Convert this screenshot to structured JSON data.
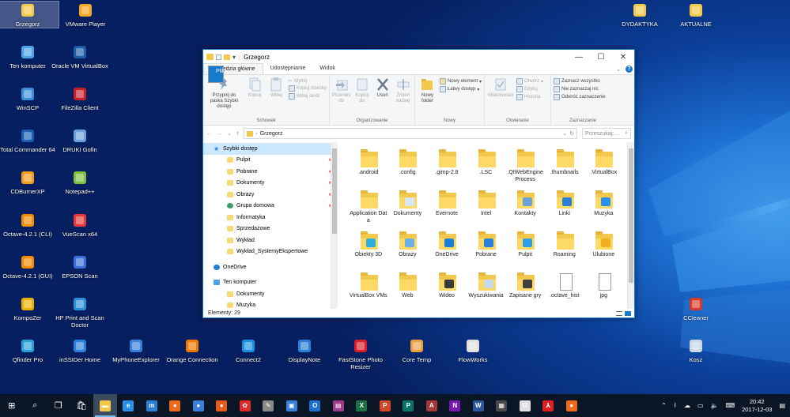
{
  "desktop_icons": [
    {
      "label": "Grzegorz",
      "icon": "user-folder-icon",
      "color": "#f2c94c"
    },
    {
      "label": "VMware Player",
      "icon": "vmware-icon",
      "color": "#f5a623"
    },
    {
      "label": "Ten komputer",
      "icon": "computer-icon",
      "color": "#4ea3e8"
    },
    {
      "label": "Oracle VM VirtualBox",
      "icon": "virtualbox-icon",
      "color": "#1d5ca8"
    },
    {
      "label": "WinSCP",
      "icon": "winscp-icon",
      "color": "#3a8fd8"
    },
    {
      "label": "FileZilla Client",
      "icon": "filezilla-icon",
      "color": "#c8202a"
    },
    {
      "label": "Total Commander 64",
      "icon": "total-commander-icon",
      "color": "#1b5fb0"
    },
    {
      "label": "DRUKI Gofin",
      "icon": "druki-gofin-icon",
      "color": "#6aa0d8"
    },
    {
      "label": "CDBurnerXP",
      "icon": "cdburnerxp-icon",
      "color": "#f29b1d"
    },
    {
      "label": "Notepad++",
      "icon": "notepad-plus-plus-icon",
      "color": "#7fbf3f"
    },
    {
      "label": "Octave-4.2.1 (CLI)",
      "icon": "octave-icon",
      "color": "#f08c00"
    },
    {
      "label": "VueScan x64",
      "icon": "vuescan-icon",
      "color": "#e83a3a"
    },
    {
      "label": "Octave-4.2.1 (GUI)",
      "icon": "octave-icon",
      "color": "#f08c00"
    },
    {
      "label": "EPSON Scan",
      "icon": "epson-scan-icon",
      "color": "#3a6fd8"
    },
    {
      "label": "KompoZer",
      "icon": "kompozer-icon",
      "color": "#e8b100"
    },
    {
      "label": "HP Print and Scan Doctor",
      "icon": "hp-doctor-icon",
      "color": "#2a8fd8"
    },
    {
      "label": "Qfinder Pro",
      "icon": "qfinder-icon",
      "color": "#2aa0d8"
    },
    {
      "label": "inSSIDer Home",
      "icon": "inssider-icon",
      "color": "#2a7fd8"
    },
    {
      "label": "MyPhoneExplorer",
      "icon": "myphoneexplorer-icon",
      "color": "#3a7fd8"
    },
    {
      "label": "Orange Connection",
      "icon": "orange-connection-icon",
      "color": "#f07800"
    },
    {
      "label": "Connect2",
      "icon": "connect2-icon",
      "color": "#1a8fe0"
    },
    {
      "label": "DisplayNote",
      "icon": "displaynote-icon",
      "color": "#2a7fd8"
    },
    {
      "label": "FastStone Photo Resizer",
      "icon": "faststone-icon",
      "color": "#d8202a"
    },
    {
      "label": "Core Temp",
      "icon": "core-temp-icon",
      "color": "#e8a040"
    },
    {
      "label": "FlowWorks",
      "icon": "flowworks-icon",
      "color": "#e0e0e0"
    },
    {
      "label": "DYDAKTYKA",
      "icon": "folder-icon",
      "color": "#f2c94c"
    },
    {
      "label": "AKTUALNE",
      "icon": "document-icon",
      "color": "#f2c94c"
    },
    {
      "label": "CCleaner",
      "icon": "ccleaner-icon",
      "color": "#d83a2a"
    },
    {
      "label": "Kosz",
      "icon": "recycle-bin-icon",
      "color": "#c8d8e8"
    }
  ],
  "window": {
    "title": "Grzegorz",
    "tabs": [
      "Plik",
      "Narzędzia główne",
      "Udostępnianie",
      "Widok"
    ],
    "active_tab": "Narzędzia główne",
    "ribbon": {
      "schowek": {
        "label": "Schowek",
        "pin": "Przypnij do paska Szybki dostęp",
        "copy": "Kopiuj",
        "paste": "Wklej",
        "cut": "Wytnij",
        "copy_path": "Kopiuj ścieżkę",
        "paste_shortcut": "Wklej skrót"
      },
      "organizowanie": {
        "label": "Organizowanie",
        "move_to": "Przenieś do",
        "copy_to": "Kopiuj do",
        "delete": "Usuń",
        "rename": "Zmień nazwę"
      },
      "nowy": {
        "label": "Nowy",
        "new_folder": "Nowy folder",
        "new_item": "Nowy element",
        "easy_access": "Łatwy dostęp"
      },
      "otwieranie": {
        "label": "Otwieranie",
        "properties": "Właściwości",
        "open": "Otwórz",
        "edit": "Edytuj",
        "history": "Historia"
      },
      "zaznaczanie": {
        "label": "Zaznaczanie",
        "select_all": "Zaznacz wszystko",
        "select_none": "Nie zaznaczaj nic",
        "invert": "Odwróć zaznaczenie"
      }
    },
    "address": {
      "path": "Grzegorz",
      "search_placeholder": "Przeszukaj:..."
    },
    "nav": [
      {
        "label": "Szybki dostęp",
        "top": true,
        "sel": true,
        "icon": "star-icon"
      },
      {
        "label": "Pulpit",
        "pin": true,
        "icon": "desktop-folder-icon"
      },
      {
        "label": "Pobrane",
        "pin": true,
        "icon": "downloads-folder-icon"
      },
      {
        "label": "Dokumenty",
        "pin": true,
        "icon": "documents-folder-icon"
      },
      {
        "label": "Obrazy",
        "pin": true,
        "icon": "pictures-folder-icon"
      },
      {
        "label": "Grupa domowa",
        "pin": true,
        "icon": "homegroup-icon"
      },
      {
        "label": "Informatyka",
        "icon": "folder-icon"
      },
      {
        "label": "Sprzedażowe",
        "icon": "folder-icon"
      },
      {
        "label": "Wykład",
        "icon": "folder-icon"
      },
      {
        "label": "Wykład_SystemyEkspertowe",
        "icon": "folder-icon"
      },
      {
        "label": "OneDrive",
        "top": true,
        "icon": "onedrive-icon"
      },
      {
        "label": "Ten komputer",
        "top": true,
        "icon": "computer-icon"
      },
      {
        "label": "Dokumenty",
        "icon": "documents-folder-icon"
      },
      {
        "label": "Muzyka",
        "icon": "music-folder-icon"
      }
    ],
    "items": [
      {
        "label": ".android",
        "type": "folder"
      },
      {
        "label": ".config",
        "type": "folder"
      },
      {
        "label": ".gimp-2.8",
        "type": "folder"
      },
      {
        "label": ".LSC",
        "type": "folder"
      },
      {
        "label": ".QtWebEngineProcess",
        "type": "folder"
      },
      {
        "label": ".thumbnails",
        "type": "folder"
      },
      {
        "label": ".VirtualBox",
        "type": "folder"
      },
      {
        "label": "Application Data",
        "type": "folder"
      },
      {
        "label": "Dokumenty",
        "type": "folder",
        "ov": "#d8e6f4"
      },
      {
        "label": "Evernote",
        "type": "folder"
      },
      {
        "label": "Intel",
        "type": "folder"
      },
      {
        "label": "Kontakty",
        "type": "folder",
        "ov": "#6aa0d8"
      },
      {
        "label": "Linki",
        "type": "folder",
        "ov": "#2a7fd8"
      },
      {
        "label": "Muzyka",
        "type": "folder",
        "ov": "#2a8fe8"
      },
      {
        "label": "Obiekty 3D",
        "type": "folder",
        "ov": "#2ab0e0"
      },
      {
        "label": "Obrazy",
        "type": "folder",
        "ov": "#6ab0e8"
      },
      {
        "label": "OneDrive",
        "type": "folder",
        "ov": "#1a7fd8"
      },
      {
        "label": "Pobrane",
        "type": "folder",
        "ov": "#2a7fd8"
      },
      {
        "label": "Pulpit",
        "type": "folder",
        "ov": "#2a9fe8"
      },
      {
        "label": "Roaming",
        "type": "folder"
      },
      {
        "label": "Ulubione",
        "type": "folder",
        "ov": "#f0b020"
      },
      {
        "label": "VirtualBox VMs",
        "type": "folder"
      },
      {
        "label": "Web",
        "type": "folder"
      },
      {
        "label": "Wideo",
        "type": "folder",
        "ov": "#3a3a3a"
      },
      {
        "label": "Wyszukiwania",
        "type": "folder",
        "ov": "#c8d8e8"
      },
      {
        "label": "Zapisane gry",
        "type": "folder",
        "ov": "#404040"
      },
      {
        "label": ".octave_hist",
        "type": "file"
      },
      {
        "label": "jpg",
        "type": "file"
      }
    ],
    "status": "Elementy: 29"
  },
  "taskbar": {
    "apps": [
      {
        "name": "start-icon",
        "color": "#ffffff",
        "glyph": "⊞"
      },
      {
        "name": "search-icon",
        "color": "#ffffff",
        "glyph": "⌕"
      },
      {
        "name": "task-view-icon",
        "color": "#ffffff",
        "glyph": "❐"
      },
      {
        "name": "store-icon",
        "color": "#ffffff",
        "glyph": "🛍"
      },
      {
        "name": "file-explorer-icon",
        "color": "#f2c94c",
        "glyph": "▬",
        "active": true
      },
      {
        "name": "edge-icon",
        "color": "#2a8fe8",
        "glyph": "e"
      },
      {
        "name": "mail-icon",
        "color": "#2a7fd8",
        "glyph": "m"
      },
      {
        "name": "firefox-icon",
        "color": "#e86a1a",
        "glyph": "●"
      },
      {
        "name": "thunderbird-icon",
        "color": "#3a7fd8",
        "glyph": "●"
      },
      {
        "name": "ubuntu-icon",
        "color": "#e85a1a",
        "glyph": "●"
      },
      {
        "name": "huawei-icon",
        "color": "#e02a2a",
        "glyph": "✿"
      },
      {
        "name": "tool-icon",
        "color": "#8a8a8a",
        "glyph": "✎"
      },
      {
        "name": "save-icon",
        "color": "#3a7fd8",
        "glyph": "▣"
      },
      {
        "name": "outlook-icon",
        "color": "#1a6fd0",
        "glyph": "O"
      },
      {
        "name": "winrar-icon",
        "color": "#a03a8a",
        "glyph": "▤"
      },
      {
        "name": "excel-icon",
        "color": "#1e7145",
        "glyph": "X"
      },
      {
        "name": "powerpoint-icon",
        "color": "#d24726",
        "glyph": "P"
      },
      {
        "name": "publisher-icon",
        "color": "#077568",
        "glyph": "P"
      },
      {
        "name": "access-icon",
        "color": "#a4373a",
        "glyph": "A"
      },
      {
        "name": "onenote-icon",
        "color": "#7719aa",
        "glyph": "N"
      },
      {
        "name": "word-icon",
        "color": "#2b579a",
        "glyph": "W"
      },
      {
        "name": "calculator-icon",
        "color": "#4a4a4a",
        "glyph": "▦"
      },
      {
        "name": "chrome-icon",
        "color": "#e0e0e0",
        "glyph": "G"
      },
      {
        "name": "acrobat-icon",
        "color": "#e02020",
        "glyph": "⅄"
      },
      {
        "name": "firefox-alt-icon",
        "color": "#e86a1a",
        "glyph": "●"
      }
    ],
    "tray": {
      "time": "20:42",
      "date": "2017-12-03"
    }
  }
}
